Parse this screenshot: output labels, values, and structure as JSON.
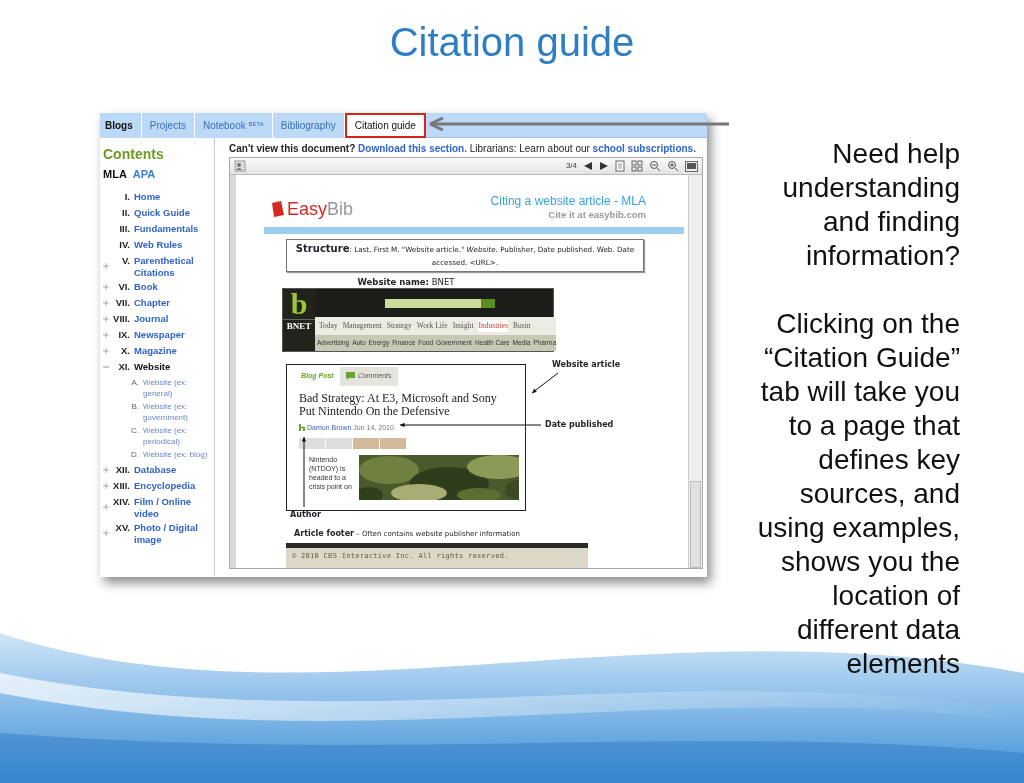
{
  "slide": {
    "title": "Citation guide"
  },
  "tabs": [
    {
      "label": "Blogs",
      "selected": false
    },
    {
      "label": "Projects",
      "selected": false
    },
    {
      "label": "Notebook",
      "badge": "BETA",
      "selected": false
    },
    {
      "label": "Bibliography",
      "selected": false
    },
    {
      "label": "Citation guide",
      "selected": true
    }
  ],
  "sidebar": {
    "heading": "Contents",
    "styles": [
      {
        "label": "MLA",
        "selected": true
      },
      {
        "label": "APA",
        "selected": false
      }
    ],
    "items": [
      {
        "numeral": "I.",
        "label": "Home",
        "selected": false
      },
      {
        "numeral": "II.",
        "label": "Quick Guide",
        "selected": false
      },
      {
        "numeral": "III.",
        "label": "Fundamentals",
        "selected": false
      },
      {
        "numeral": "IV.",
        "label": "Web Rules",
        "selected": false
      },
      {
        "numeral": "V.",
        "label": "Parenthetical Citations",
        "selected": false,
        "expanded": false
      },
      {
        "numeral": "VI.",
        "label": "Book",
        "selected": false,
        "expanded": false
      },
      {
        "numeral": "VII.",
        "label": "Chapter",
        "selected": false,
        "expanded": false
      },
      {
        "numeral": "VIII.",
        "label": "Journal",
        "selected": false,
        "expanded": false
      },
      {
        "numeral": "IX.",
        "label": "Newspaper",
        "selected": false,
        "expanded": false
      },
      {
        "numeral": "X.",
        "label": "Magazine",
        "selected": false,
        "expanded": false
      },
      {
        "numeral": "XI.",
        "label": "Website",
        "selected": true,
        "expanded": true,
        "children": [
          {
            "numeral": "A.",
            "label": "Website (ex: general)"
          },
          {
            "numeral": "B.",
            "label": "Website (ex: government)"
          },
          {
            "numeral": "C.",
            "label": "Website (ex: periodical)"
          },
          {
            "numeral": "D.",
            "label": "Website (ex: blog)"
          }
        ]
      },
      {
        "numeral": "XII.",
        "label": "Database",
        "selected": false,
        "expanded": false
      },
      {
        "numeral": "XIII.",
        "label": "Encyclopedia",
        "selected": false,
        "expanded": false
      },
      {
        "numeral": "XIV.",
        "label": "Film / Online video",
        "selected": false,
        "expanded": false
      },
      {
        "numeral": "XV.",
        "label": "Photo / Digital image",
        "selected": false,
        "expanded": false
      }
    ]
  },
  "notice": {
    "lead": "Can't view this document?",
    "link": "Download this section.",
    "text": "Librarians: Learn about our",
    "link_2": "school subscriptions."
  },
  "viewer": {
    "page": "3/4"
  },
  "document": {
    "logo_parts": [
      "Easy",
      "Bib"
    ],
    "heading": "Citing a website article - MLA",
    "subheading": "Cite it at easybib.com",
    "structure": "**Structure**: Last, First M. \"Website article.\" *Website*. Publisher, Date published. Web. Date accessed. <URL>.",
    "website_name": "**Website name:** BNET",
    "bnet": {
      "logo": "b",
      "name": "BNET",
      "nav": [
        {
          "label": "Today",
          "selected": false
        },
        {
          "label": "Management",
          "selected": false
        },
        {
          "label": "Strategy",
          "selected": false
        },
        {
          "label": "Work Life",
          "selected": false
        },
        {
          "label": "Insight",
          "selected": false
        },
        {
          "label": "Industries",
          "selected": true
        },
        {
          "label": "Busin",
          "selected": false
        }
      ],
      "subnav": [
        "Advertising",
        "Auto",
        "Energy",
        "Finance",
        "Food",
        "Government",
        "Health Care",
        "Media",
        "Pharma"
      ]
    },
    "article": {
      "tabs": [
        "Blog Post",
        "Comments"
      ],
      "title": "Bad Strategy: At E3, Microsoft and Sony Put Nintendo On the Defensive",
      "author": "Damon Brown",
      "date": "Jun 14, 2010",
      "body": "Nintendo (NTDOY) is headed to a crisis point on"
    },
    "annotations": {
      "website_article": "Website article",
      "date_published": "Date published",
      "author": "Author"
    },
    "footer_label": "**Article footer** – Often contains website publisher information",
    "footer_text": "© 2010 CBS Interactive Inc. All rights reserved."
  },
  "notes": [
    "Need help understanding and finding information?",
    "Clicking on the “Citation Guide” tab will take you to a page that defines key sources, and using examples, shows you the location of different data elements"
  ]
}
